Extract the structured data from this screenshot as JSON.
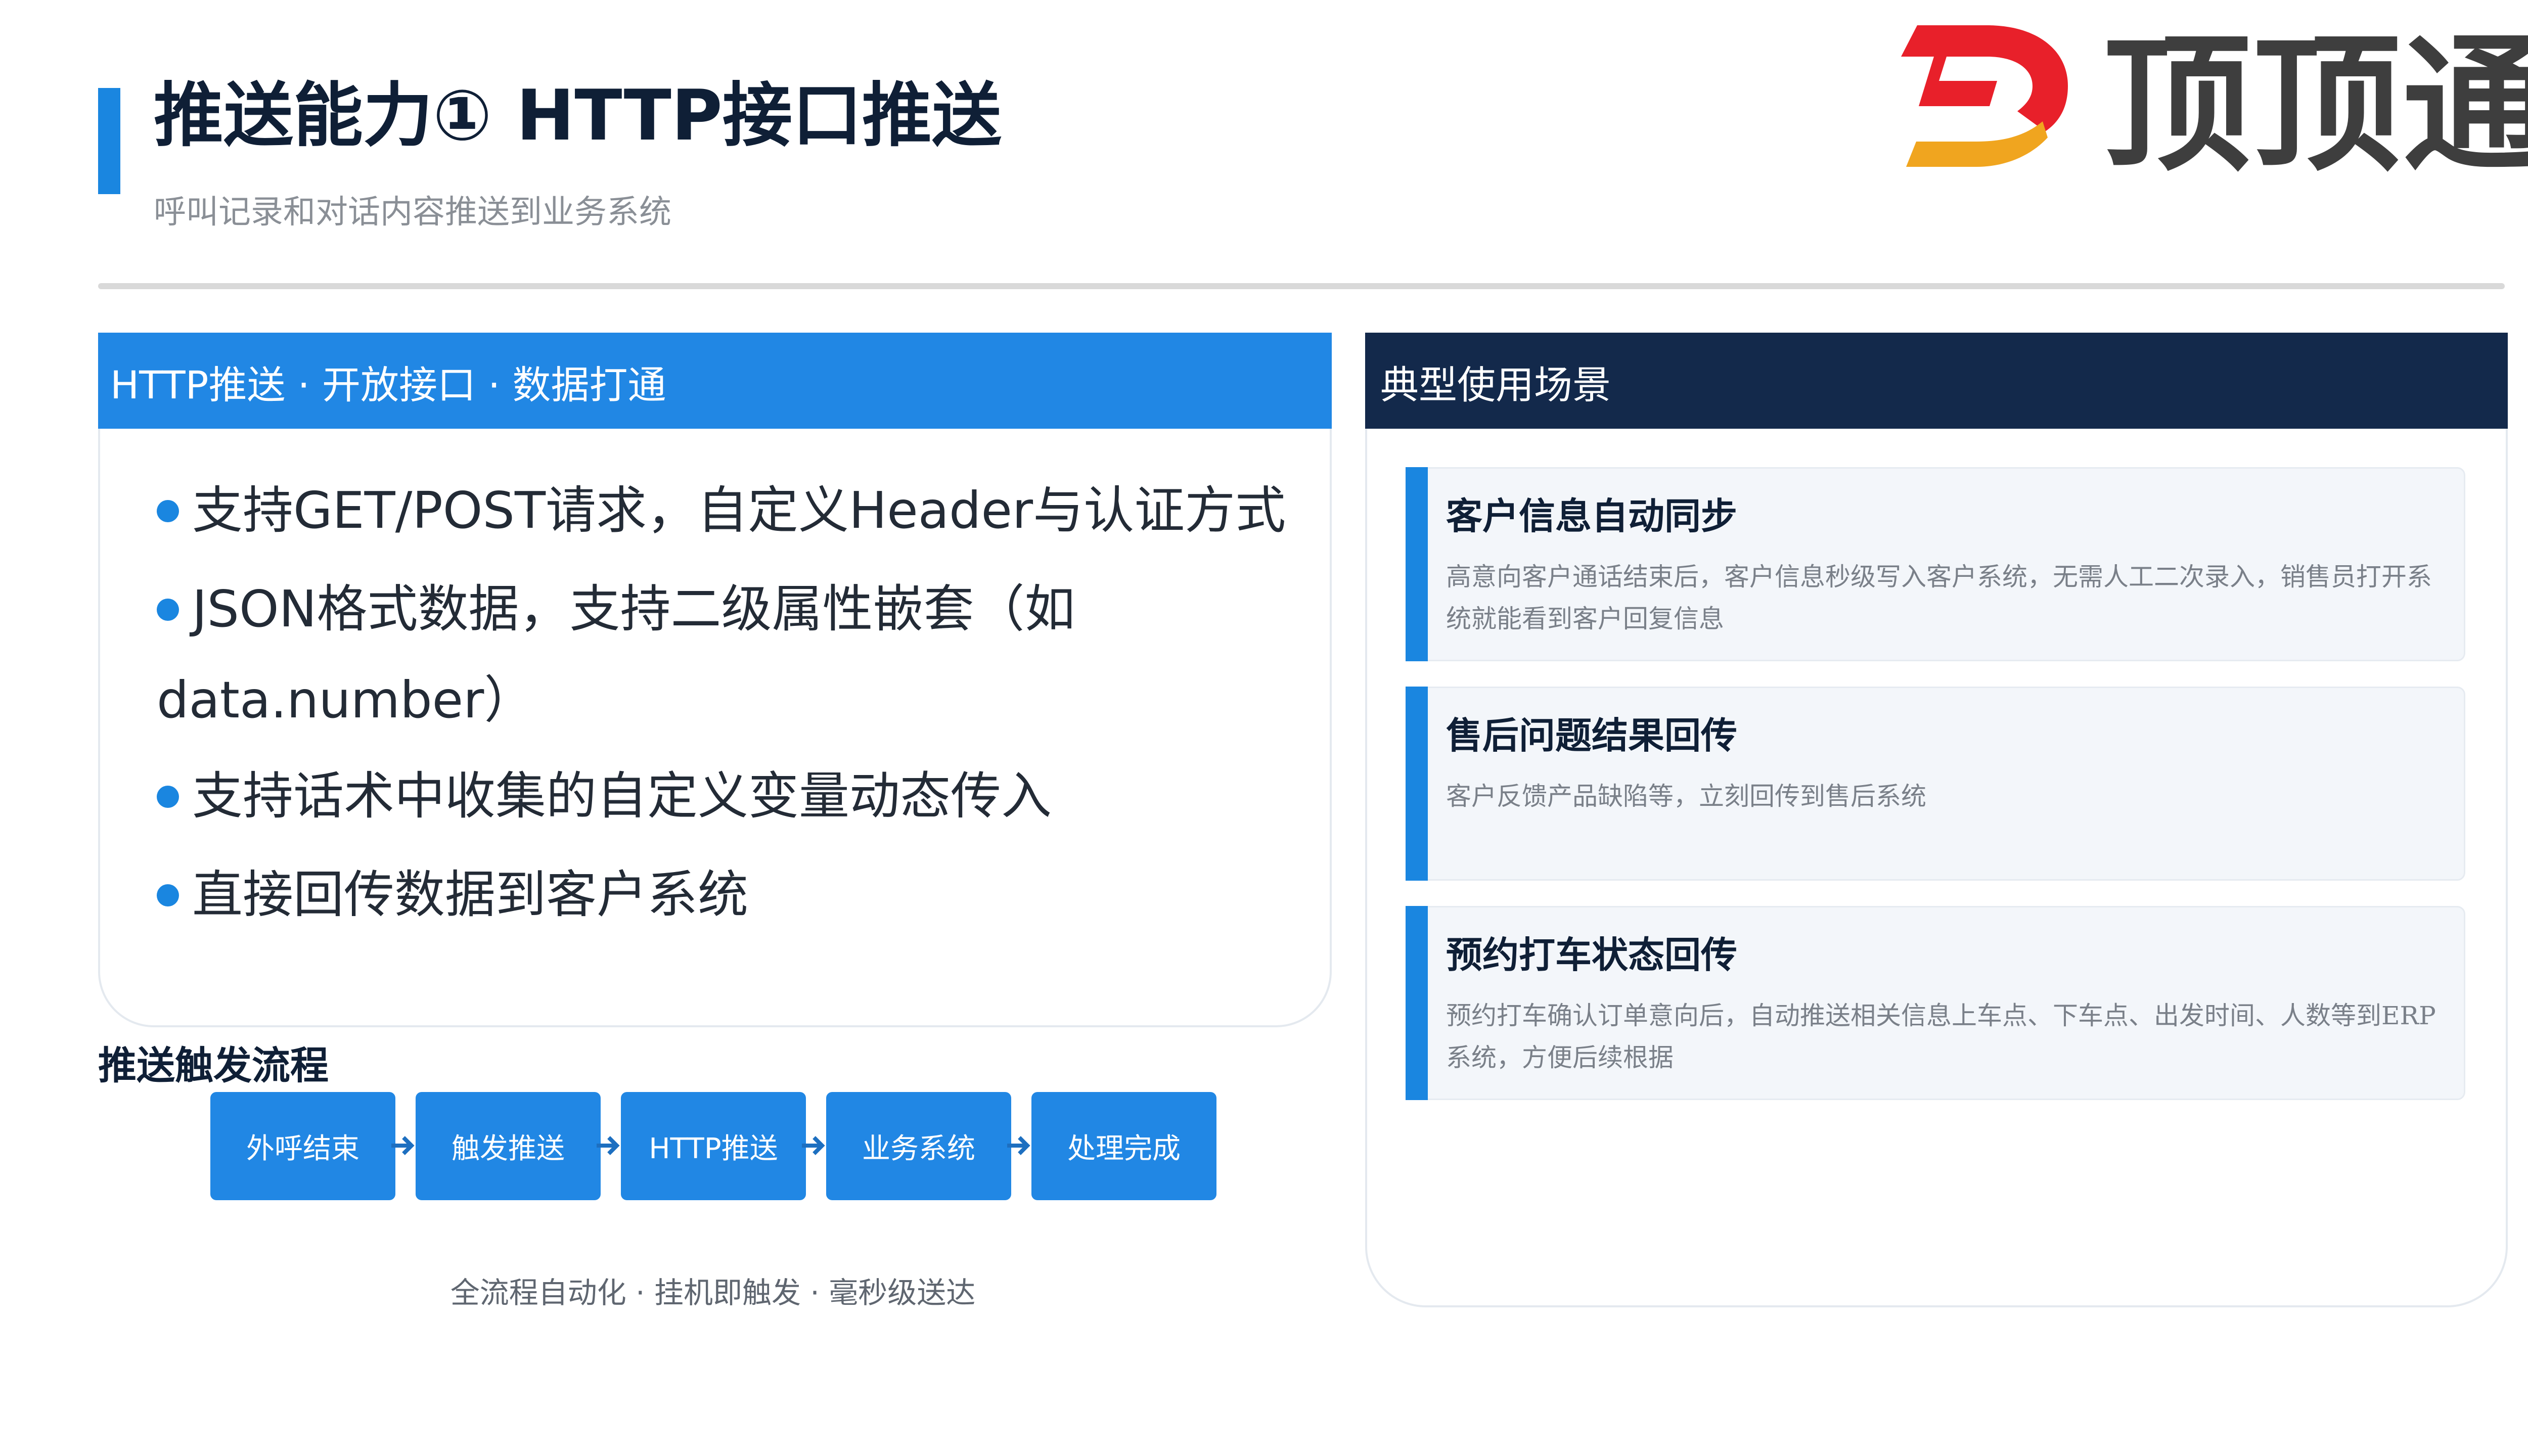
{
  "header": {
    "title": "推送能力① HTTP接口推送",
    "subtitle": "呼叫记录和对话内容推送到业务系统"
  },
  "logo": {
    "text": "顶顶通",
    "icon": "dingdingtong-d-logo-icon",
    "colors": {
      "red": "#e8202a",
      "orange": "#f0a51f"
    }
  },
  "left_panel": {
    "header": "HTTP推送 · 开放接口 · 数据打通",
    "bullets": [
      "支持GET/POST请求，自定义Header与认证方式",
      "JSON格式数据，支持二级属性嵌套（如",
      "支持话术中收集的自定义变量动态传入",
      "直接回传数据到客户系统"
    ],
    "bullet_continuation": "data.number）"
  },
  "flow": {
    "title": "推送触发流程",
    "steps": [
      "外呼结束",
      "触发推送",
      "HTTP推送",
      "业务系统",
      "处理完成"
    ],
    "caption": "全流程自动化 · 挂机即触发 · 毫秒级送达"
  },
  "right_panel": {
    "header": "典型使用场景",
    "cards": [
      {
        "title": "客户信息自动同步",
        "desc": "高意向客户通话结束后，客户信息秒级写入客户系统，无需人工二次录入，销售员打开系统就能看到客户回复信息"
      },
      {
        "title": "售后问题结果回传",
        "desc": "客户反馈产品缺陷等，立刻回传到售后系统"
      },
      {
        "title": "预约打车状态回传",
        "desc": "预约打车确认订单意向后，自动推送相关信息上车点、下车点、出发时间、人数等到ERP系统，方便后续根据"
      }
    ]
  },
  "colors": {
    "accent_blue": "#2187e4",
    "navy": "#13294b",
    "card_bg": "#f3f6fa"
  }
}
